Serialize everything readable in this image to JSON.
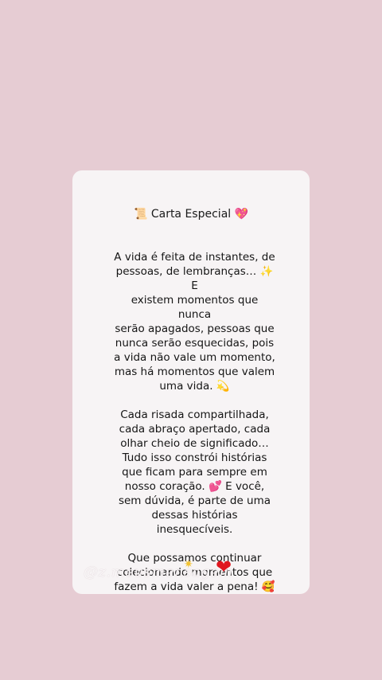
{
  "card": {
    "title": "📜 Carta Especial 💖",
    "paragraphs": [
      "A vida é feita de instantes, de\npessoas, de lembranças… ✨ E\nexistem momentos que nunca\nserão apagados, pessoas que\nnunca serão esquecidas, pois\na vida não vale um momento,\nmas há momentos que valem\numa vida. 💫",
      "Cada risada compartilhada,\ncada abraço apertado, cada\nolhar cheio de significado…\nTudo isso constrói histórias\nque ficam para sempre em\nnosso coração. 💕 E você,\nsem dúvida, é parte de uma\ndessas histórias\ninesquecíveis.",
      "Que possamos continuar\ncolecionando momentos que\nfazem a vida valer a pena! 🥰"
    ],
    "watermark": "@z.meusmensagem",
    "sparkle_glyph": "✷",
    "heart_glyph": "❤"
  }
}
